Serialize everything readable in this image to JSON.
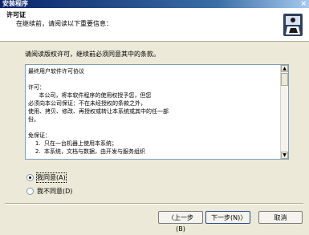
{
  "window": {
    "title": "安装程序",
    "close_glyph": "×"
  },
  "header": {
    "title": "许可证",
    "subtitle": "在继续前，请阅读以下重要信息："
  },
  "instruction": "请阅读版权许可，继续前必须同意其中的条款。",
  "license_text": "最终用户软件许可协议\n\n许可：\n      本公司，将本软件程序的使用权授予您，但您\n必须向本公司保证：不在未经授权的条款之外，\n使用、拷贝、修改、再授权或转让本系统或其中的任一部\n份。\n\n免保证：\n    1.  只在一台机器上使用本系统；\n    2.  本系统，文档与数据，由开发与服务组织",
  "options": {
    "agree": "我同意(A)",
    "disagree": "我不同意(D)",
    "selected": "agree"
  },
  "buttons": {
    "back": "〈上一步(B)",
    "next": "下一步(N)〉",
    "cancel": "取消"
  },
  "colors": {
    "titlebar_start": "#0a246a",
    "dialog_bg": "#ece9d8",
    "header_bg": "#ffffff"
  }
}
